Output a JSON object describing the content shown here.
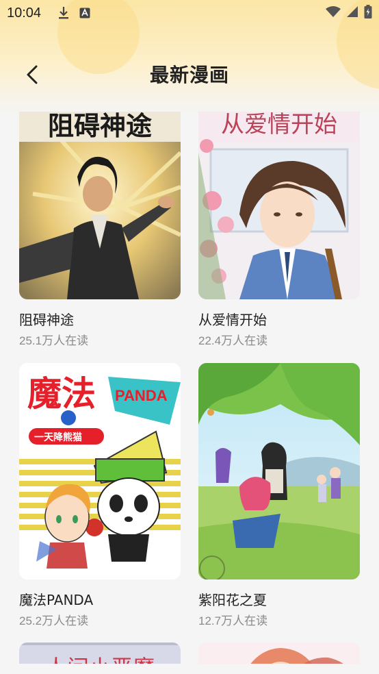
{
  "status_bar": {
    "time": "10:04",
    "icons_left": [
      "download-icon",
      "a-box-icon"
    ],
    "icons_right": [
      "wifi-icon",
      "signal-icon",
      "battery-icon"
    ]
  },
  "header": {
    "title": "最新漫画",
    "back_icon": "chevron-left-icon"
  },
  "comics": [
    {
      "title": "阻碍神途",
      "reads": "25.1万人在读"
    },
    {
      "title": "从爱情开始",
      "reads": "22.4万人在读"
    },
    {
      "title": "魔法PANDA",
      "reads": "25.2万人在读"
    },
    {
      "title": "紫阳花之夏",
      "reads": "12.7万人在读"
    }
  ],
  "cover_texts": {
    "c1": "阻碍神途",
    "c2": "从爱情开始",
    "c3_big": "魔法",
    "c3_panda": "PANDA",
    "c3_sub": "一天降熊猫",
    "c5": "人间小恶魔"
  },
  "colors": {
    "accent_yellow": "#fbe6a6",
    "title_text": "#222222",
    "muted_text": "#8a8a8a"
  }
}
